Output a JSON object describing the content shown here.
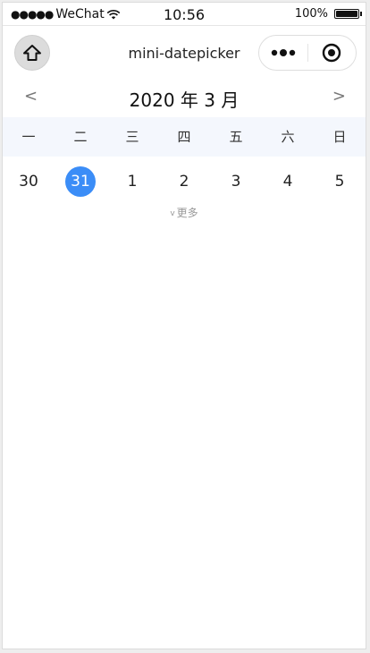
{
  "status_bar": {
    "carrier": "WeChat",
    "time": "10:56",
    "battery": "100%"
  },
  "nav": {
    "title": "mini-datepicker"
  },
  "calendar": {
    "prev": "<",
    "next": ">",
    "month_title": "2020 年 3 月",
    "weekdays": [
      "一",
      "二",
      "三",
      "四",
      "五",
      "六",
      "日"
    ],
    "days": [
      "30",
      "31",
      "1",
      "2",
      "3",
      "4",
      "5"
    ],
    "selected_index": 1,
    "expand_label": "更多"
  },
  "colors": {
    "selected": "#3b8df7",
    "weekday_bg": "#f4f7fd"
  },
  "icons": {
    "home": "home-icon",
    "more": "more-dots-icon",
    "close": "target-circle-icon",
    "wifi": "wifi-icon",
    "battery": "battery-icon"
  }
}
